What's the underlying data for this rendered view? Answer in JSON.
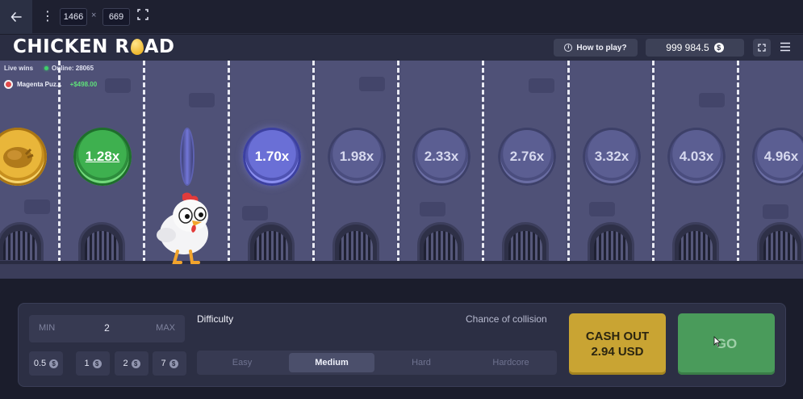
{
  "toolbar": {
    "width_value": "1466",
    "times": "×",
    "height_value": "669"
  },
  "header": {
    "logo_part1": "CHICKEN R",
    "logo_part2": "AD",
    "how_to_play": "How to play?",
    "balance": "999 984.5",
    "currency_symbol": "$"
  },
  "feed": {
    "live_wins": "Live wins",
    "online": "Online: 28065",
    "last_win_user": "Magenta Puz...",
    "last_win_amount": "+$498.00"
  },
  "lanes": {
    "multipliers": [
      "1.28x",
      "1.70x",
      "1.98x",
      "2.33x",
      "2.76x",
      "3.32x",
      "4.03x",
      "4.96x"
    ],
    "current_multiplier": "1.28x"
  },
  "controls": {
    "bet_min": "MIN",
    "bet_value": "2",
    "bet_max": "MAX",
    "quick_bets": [
      "0.5",
      "1",
      "2",
      "7"
    ],
    "difficulty_label": "Difficulty",
    "collision_label": "Chance of collision",
    "difficulties": [
      "Easy",
      "Medium",
      "Hard",
      "Hardcore"
    ],
    "selected_difficulty": "Medium",
    "cashout_line1": "CASH OUT",
    "cashout_line2": "2.94 USD",
    "go_label": "GO"
  },
  "colors": {
    "accent_green": "#4a9b5b",
    "accent_gold": "#c9a433",
    "win_green": "#5fe07a"
  }
}
